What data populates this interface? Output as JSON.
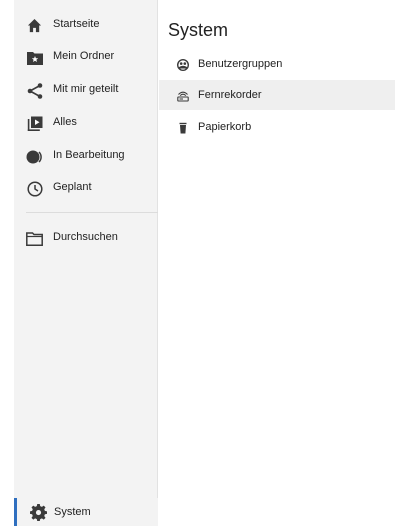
{
  "sidebar": {
    "items": [
      {
        "label": "Startseite",
        "icon": "home-icon"
      },
      {
        "label": "Mein Ordner",
        "icon": "folder-star-icon"
      },
      {
        "label": "Mit mir geteilt",
        "icon": "share-icon"
      },
      {
        "label": "Alles",
        "icon": "media-library-icon"
      },
      {
        "label": "In Bearbeitung",
        "icon": "in-progress-icon"
      },
      {
        "label": "Geplant",
        "icon": "clock-icon"
      }
    ],
    "browse": {
      "label": "Durchsuchen",
      "icon": "folder-outline-icon"
    },
    "system": {
      "label": "System",
      "icon": "gear-icon"
    }
  },
  "main": {
    "title": "System",
    "items": [
      {
        "label": "Benutzergruppen",
        "icon": "user-groups-icon",
        "selected": false
      },
      {
        "label": "Fernrekorder",
        "icon": "remote-recorder-icon",
        "selected": true
      },
      {
        "label": "Papierkorb",
        "icon": "trash-icon",
        "selected": false
      }
    ]
  },
  "colors": {
    "accent": "#2f6fbf",
    "sidebar_bg": "#f3f3f3",
    "selected_bg": "#efefef",
    "icon": "#3a3a3a"
  }
}
